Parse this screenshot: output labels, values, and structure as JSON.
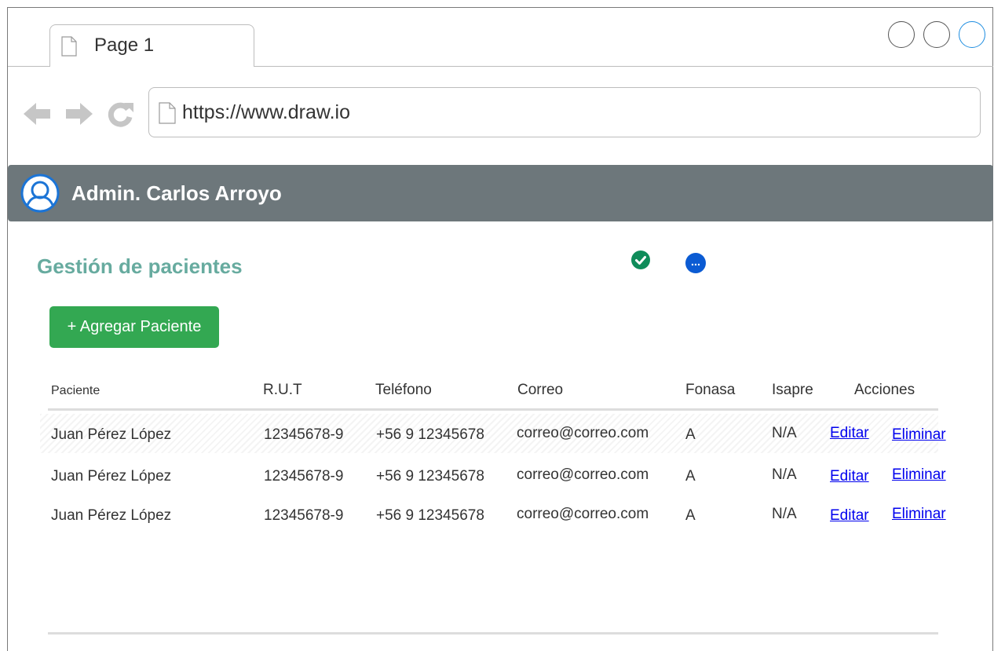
{
  "browser": {
    "tab_title": "Page 1",
    "url": "https://www.draw.io"
  },
  "header": {
    "user_name": "Admin. Carlos Arroyo"
  },
  "main": {
    "title": "Gestión de pacientes",
    "add_button": "+ Agregar Paciente",
    "columns": [
      "Paciente",
      "R.U.T",
      "Teléfono",
      "Correo",
      "Fonasa",
      "Isapre",
      "Acciones"
    ],
    "rows": [
      {
        "paciente": "Juan Pérez López",
        "rut": "12345678-9",
        "telefono": "+56 9 12345678",
        "correo": "correo@correo.com",
        "fonasa": "A",
        "isapre": "N/A",
        "editar": "Editar",
        "eliminar": "Eliminar"
      },
      {
        "paciente": "Juan Pérez López",
        "rut": "12345678-9",
        "telefono": "+56 9 12345678",
        "correo": "correo@correo.com",
        "fonasa": "A",
        "isapre": "N/A",
        "editar": "Editar",
        "eliminar": "Eliminar"
      },
      {
        "paciente": "Juan Pérez López",
        "rut": "12345678-9",
        "telefono": "+56 9 12345678",
        "correo": "correo@correo.com",
        "fonasa": "A",
        "isapre": "N/A",
        "editar": "Editar",
        "eliminar": "Eliminar"
      }
    ]
  },
  "icons": {
    "status_ok": "check-circle-icon",
    "status_more": "more-circle-icon",
    "avatar": "user-avatar-icon"
  },
  "colors": {
    "header_bg": "#6d777b",
    "title": "#67ab9f",
    "add_button": "#33a852",
    "status_ok": "#0f8c5a",
    "status_more": "#0b5bd3",
    "link": "#0000ee",
    "window_button_accent": "#1e8de0"
  }
}
